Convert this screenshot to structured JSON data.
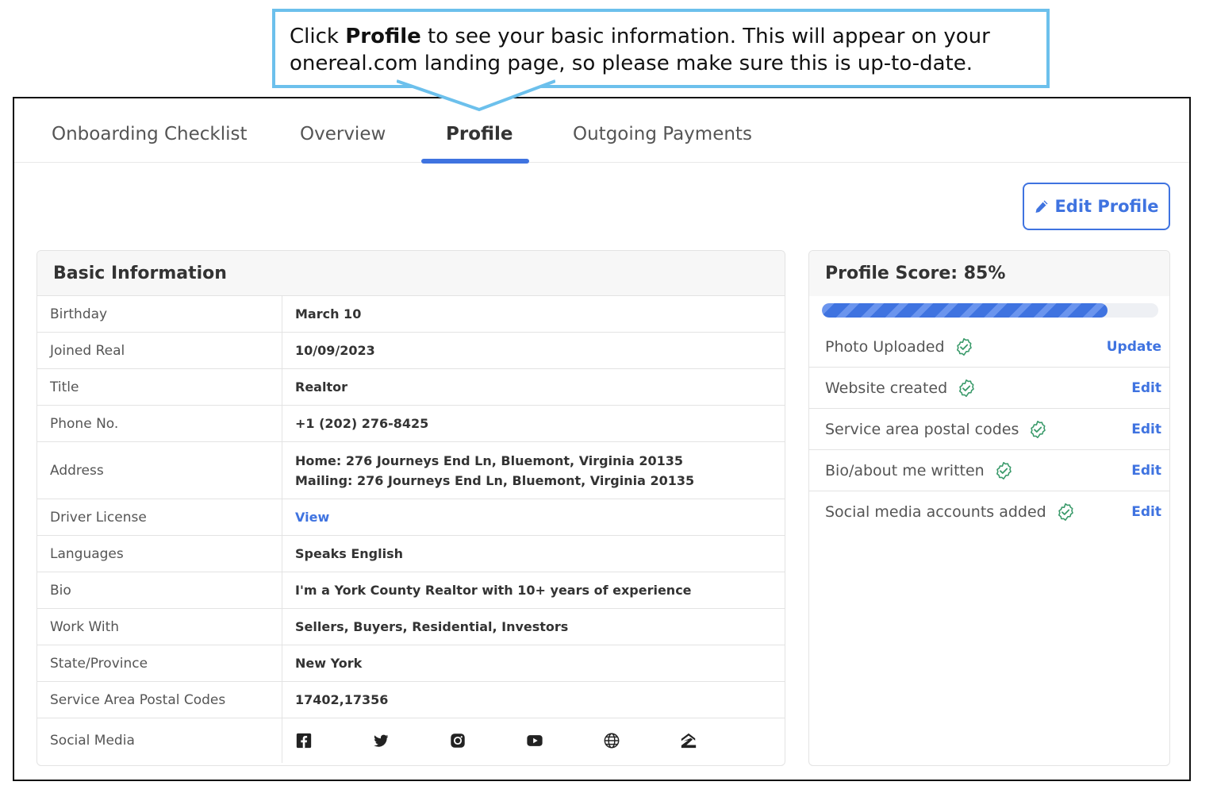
{
  "callout": {
    "prefix": "Click ",
    "bold": "Profile",
    "line1_rest": " to see your basic information. This will appear on your",
    "line2": "onereal.com landing page, so please make sure this is up-to-date."
  },
  "tabs": [
    {
      "label": "Onboarding Checklist"
    },
    {
      "label": "Overview"
    },
    {
      "label": "Profile",
      "active": true
    },
    {
      "label": "Outgoing Payments"
    }
  ],
  "edit_button": {
    "label": "Edit Profile",
    "icon": "pencil-icon"
  },
  "basic_info": {
    "title": "Basic Information",
    "rows": [
      {
        "label": "Birthday",
        "value": "March 10"
      },
      {
        "label": "Joined Real",
        "value": "10/09/2023"
      },
      {
        "label": "Title",
        "value": "Realtor"
      },
      {
        "label": "Phone No.",
        "value": "+1 (202) 276-8425"
      },
      {
        "label": "Address",
        "value": "Home: 276 Journeys End Ln, Bluemont, Virginia 20135",
        "value2": "Mailing: 276 Journeys End Ln, Bluemont, Virginia 20135"
      },
      {
        "label": "Driver License",
        "value": "View"
      },
      {
        "label": "Languages",
        "value": "Speaks English"
      },
      {
        "label": "Bio",
        "value": "I'm a York County Realtor with 10+ years of experience"
      },
      {
        "label": "Work With",
        "value": "Sellers, Buyers, Residential, Investors"
      },
      {
        "label": "State/Province",
        "value": "New York"
      },
      {
        "label": "Service Area Postal Codes",
        "value": "17402,17356"
      },
      {
        "label": "Social Media",
        "icons": [
          "facebook-icon",
          "twitter-icon",
          "instagram-icon",
          "youtube-icon",
          "website-globe-icon",
          "zillow-icon"
        ]
      }
    ]
  },
  "profile_score": {
    "title": "Profile Score: 85%",
    "progress": 0.85,
    "items": [
      {
        "label": "Photo Uploaded",
        "action": "Update"
      },
      {
        "label": "Website created",
        "action": "Edit"
      },
      {
        "label": "Service area postal codes",
        "action": "Edit"
      },
      {
        "label": "Bio/about me written",
        "action": "Edit"
      },
      {
        "label": "Social media accounts added",
        "action": "Edit"
      }
    ]
  },
  "colors": {
    "accent": "#3f73e0",
    "callout_border": "#6cc0ec",
    "check": "#3a9a6a"
  }
}
